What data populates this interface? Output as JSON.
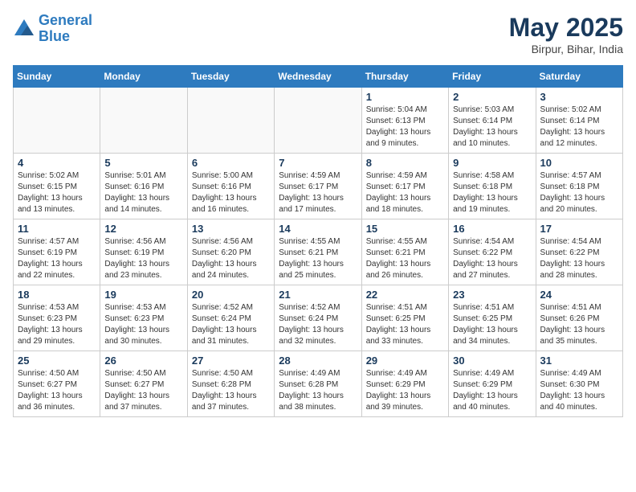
{
  "header": {
    "logo_line1": "General",
    "logo_line2": "Blue",
    "month_title": "May 2025",
    "location": "Birpur, Bihar, India"
  },
  "weekdays": [
    "Sunday",
    "Monday",
    "Tuesday",
    "Wednesday",
    "Thursday",
    "Friday",
    "Saturday"
  ],
  "weeks": [
    [
      {
        "day": "",
        "info": ""
      },
      {
        "day": "",
        "info": ""
      },
      {
        "day": "",
        "info": ""
      },
      {
        "day": "",
        "info": ""
      },
      {
        "day": "1",
        "info": "Sunrise: 5:04 AM\nSunset: 6:13 PM\nDaylight: 13 hours\nand 9 minutes."
      },
      {
        "day": "2",
        "info": "Sunrise: 5:03 AM\nSunset: 6:14 PM\nDaylight: 13 hours\nand 10 minutes."
      },
      {
        "day": "3",
        "info": "Sunrise: 5:02 AM\nSunset: 6:14 PM\nDaylight: 13 hours\nand 12 minutes."
      }
    ],
    [
      {
        "day": "4",
        "info": "Sunrise: 5:02 AM\nSunset: 6:15 PM\nDaylight: 13 hours\nand 13 minutes."
      },
      {
        "day": "5",
        "info": "Sunrise: 5:01 AM\nSunset: 6:16 PM\nDaylight: 13 hours\nand 14 minutes."
      },
      {
        "day": "6",
        "info": "Sunrise: 5:00 AM\nSunset: 6:16 PM\nDaylight: 13 hours\nand 16 minutes."
      },
      {
        "day": "7",
        "info": "Sunrise: 4:59 AM\nSunset: 6:17 PM\nDaylight: 13 hours\nand 17 minutes."
      },
      {
        "day": "8",
        "info": "Sunrise: 4:59 AM\nSunset: 6:17 PM\nDaylight: 13 hours\nand 18 minutes."
      },
      {
        "day": "9",
        "info": "Sunrise: 4:58 AM\nSunset: 6:18 PM\nDaylight: 13 hours\nand 19 minutes."
      },
      {
        "day": "10",
        "info": "Sunrise: 4:57 AM\nSunset: 6:18 PM\nDaylight: 13 hours\nand 20 minutes."
      }
    ],
    [
      {
        "day": "11",
        "info": "Sunrise: 4:57 AM\nSunset: 6:19 PM\nDaylight: 13 hours\nand 22 minutes."
      },
      {
        "day": "12",
        "info": "Sunrise: 4:56 AM\nSunset: 6:19 PM\nDaylight: 13 hours\nand 23 minutes."
      },
      {
        "day": "13",
        "info": "Sunrise: 4:56 AM\nSunset: 6:20 PM\nDaylight: 13 hours\nand 24 minutes."
      },
      {
        "day": "14",
        "info": "Sunrise: 4:55 AM\nSunset: 6:21 PM\nDaylight: 13 hours\nand 25 minutes."
      },
      {
        "day": "15",
        "info": "Sunrise: 4:55 AM\nSunset: 6:21 PM\nDaylight: 13 hours\nand 26 minutes."
      },
      {
        "day": "16",
        "info": "Sunrise: 4:54 AM\nSunset: 6:22 PM\nDaylight: 13 hours\nand 27 minutes."
      },
      {
        "day": "17",
        "info": "Sunrise: 4:54 AM\nSunset: 6:22 PM\nDaylight: 13 hours\nand 28 minutes."
      }
    ],
    [
      {
        "day": "18",
        "info": "Sunrise: 4:53 AM\nSunset: 6:23 PM\nDaylight: 13 hours\nand 29 minutes."
      },
      {
        "day": "19",
        "info": "Sunrise: 4:53 AM\nSunset: 6:23 PM\nDaylight: 13 hours\nand 30 minutes."
      },
      {
        "day": "20",
        "info": "Sunrise: 4:52 AM\nSunset: 6:24 PM\nDaylight: 13 hours\nand 31 minutes."
      },
      {
        "day": "21",
        "info": "Sunrise: 4:52 AM\nSunset: 6:24 PM\nDaylight: 13 hours\nand 32 minutes."
      },
      {
        "day": "22",
        "info": "Sunrise: 4:51 AM\nSunset: 6:25 PM\nDaylight: 13 hours\nand 33 minutes."
      },
      {
        "day": "23",
        "info": "Sunrise: 4:51 AM\nSunset: 6:25 PM\nDaylight: 13 hours\nand 34 minutes."
      },
      {
        "day": "24",
        "info": "Sunrise: 4:51 AM\nSunset: 6:26 PM\nDaylight: 13 hours\nand 35 minutes."
      }
    ],
    [
      {
        "day": "25",
        "info": "Sunrise: 4:50 AM\nSunset: 6:27 PM\nDaylight: 13 hours\nand 36 minutes."
      },
      {
        "day": "26",
        "info": "Sunrise: 4:50 AM\nSunset: 6:27 PM\nDaylight: 13 hours\nand 37 minutes."
      },
      {
        "day": "27",
        "info": "Sunrise: 4:50 AM\nSunset: 6:28 PM\nDaylight: 13 hours\nand 37 minutes."
      },
      {
        "day": "28",
        "info": "Sunrise: 4:49 AM\nSunset: 6:28 PM\nDaylight: 13 hours\nand 38 minutes."
      },
      {
        "day": "29",
        "info": "Sunrise: 4:49 AM\nSunset: 6:29 PM\nDaylight: 13 hours\nand 39 minutes."
      },
      {
        "day": "30",
        "info": "Sunrise: 4:49 AM\nSunset: 6:29 PM\nDaylight: 13 hours\nand 40 minutes."
      },
      {
        "day": "31",
        "info": "Sunrise: 4:49 AM\nSunset: 6:30 PM\nDaylight: 13 hours\nand 40 minutes."
      }
    ]
  ]
}
